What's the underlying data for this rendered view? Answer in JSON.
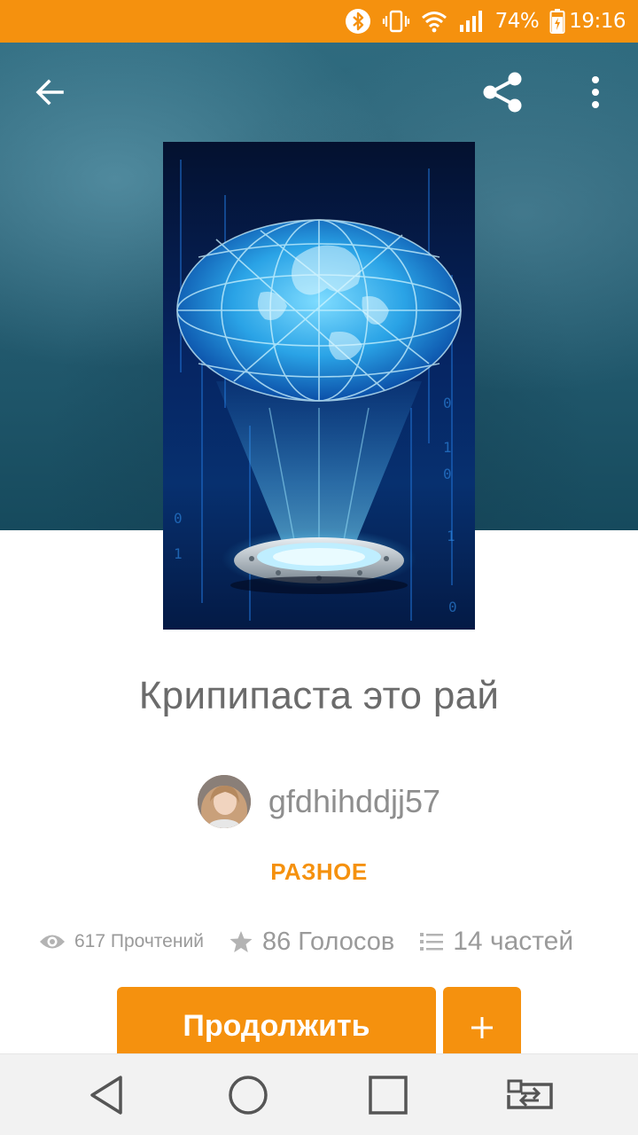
{
  "status_bar": {
    "battery": "74%",
    "time": "19:16",
    "icons": [
      "bluetooth-icon",
      "vibrate-icon",
      "wifi-icon",
      "signal-icon",
      "battery-charging-icon"
    ]
  },
  "toolbar": {
    "icons": [
      "back-arrow-icon",
      "share-icon",
      "more-vertical-icon"
    ]
  },
  "story": {
    "title": "Крипипаста это рай",
    "author": "gfdhihddjj57",
    "category": "РАЗНОЕ",
    "stats": {
      "reads": "617 Прочтений",
      "votes": "86 Голосов",
      "parts": "14 частей"
    }
  },
  "actions": {
    "continue_label": "Продолжить",
    "add_label": "+"
  },
  "nav_bar": {
    "icons": [
      "nav-back-icon",
      "nav-home-icon",
      "nav-recent-apps-icon",
      "nav-switch-icon"
    ]
  },
  "colors": {
    "accent": "#f5910e",
    "header_bg": "#2a6074",
    "text_primary": "#6b6b6b",
    "text_secondary": "#9a9a9a"
  }
}
